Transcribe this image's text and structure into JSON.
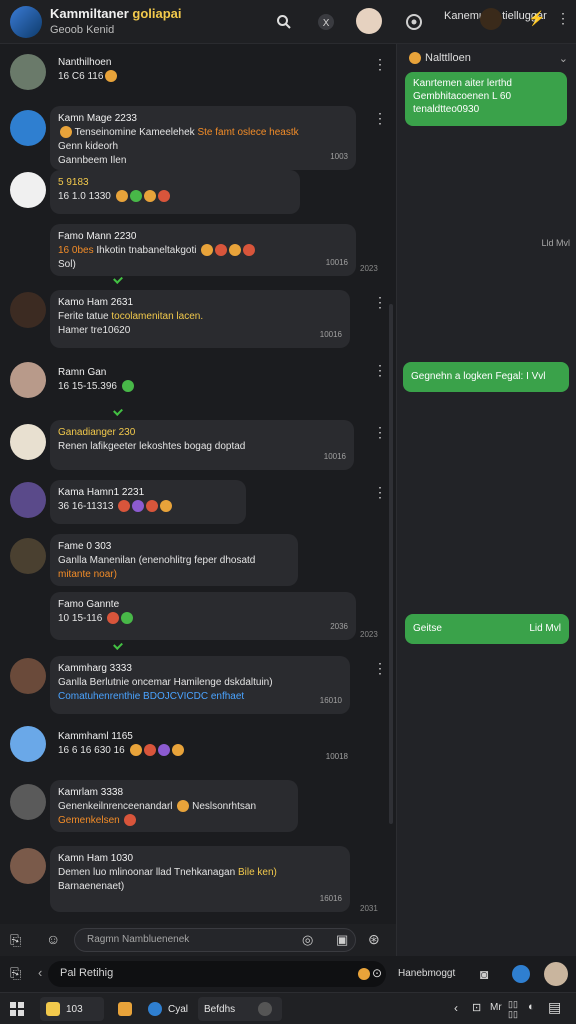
{
  "topbar": {
    "title_main": "Kammiltaner",
    "title_accent": "goliapai",
    "subtitle": "Geoob Kenid",
    "search_icon": "search-icon",
    "mute_icon": "mute-icon",
    "settings_icon": "gear-icon",
    "right_title": "Kanemunsi tielluggar"
  },
  "messages": [
    {
      "name": "Nanthilhoen",
      "text": "16 C6 116",
      "time": ""
    },
    {
      "name": "Kamn Mage 2233",
      "line1_pre": "Tenseinomine Kameelehek",
      "line1_hl": "Ste famt oslece heastk",
      "line2": "Genn kideorh",
      "line3": "Gannbeem Ilen",
      "time": "1003"
    },
    {
      "name": "5 9183",
      "text": "16 1.0 1330",
      "time": ""
    },
    {
      "name": "Famo Mann 2230",
      "line1_hl": "16 0bes",
      "line1_post": "Ihkotin tnabaneltakgoti",
      "line2": "Sol)",
      "time": "10016",
      "time2": "2023"
    },
    {
      "name": "Kamo Ham 2631",
      "line1": "Ferite tatue",
      "line1_hl": "tocolamenitan lacen.",
      "line2": "Hamer tre10620",
      "time": "10016"
    },
    {
      "name": "Ramn Gan",
      "text": "16 15-15.396",
      "time": ""
    },
    {
      "name": "Ganadianger 230",
      "line1": "Renen lafikgeeter  lekoshtes  bogag doptad",
      "time": "10016"
    },
    {
      "name": "Kama Hamn1 2231",
      "text": "36 16-11313",
      "time": ""
    },
    {
      "name": "Fame 0 303",
      "line1": "Ganlla Manenilan (enenohlitrg feper dhosatd",
      "line2_hl": "mitante noar)",
      "time": ""
    },
    {
      "name": "Famo Gannte",
      "text": "10 15-116",
      "time": "2036",
      "time2": "2023"
    },
    {
      "name": "Kammharg 3333",
      "line1": "Ganlla Berlutnie oncemar Hamilenge dskdaltuin)",
      "line2_hl": "Comatuhenrenthie BDOJCVICDC enfhaet",
      "time": "16010"
    },
    {
      "name": "Kammhaml 1165",
      "text": "16 6 16 630 16",
      "time": "10018"
    },
    {
      "name": "Kamrlam 3338",
      "line1": "Genenkeilnrenceenandarl",
      "line1_post": "Neslsonrhtsan",
      "line2_hl": "Gemenkelsen",
      "time": ""
    },
    {
      "name": "Kamn Ham 1030",
      "line1": "Demen luo mlinoonar llad",
      "line1_post": "Tnehkanagan",
      "line1_hl": "Bile ken)",
      "line2": "Barnaenenaet)",
      "time": "16016",
      "time2": "2031"
    }
  ],
  "side": {
    "header": "Nalttlloen",
    "bubble1_l1": "Kanrtemen aiter lerthd",
    "bubble1_l2": "Gembhitacoenen L 60",
    "bubble1_l3": "tenaldtteo0930",
    "time_a": "Lld Mvl",
    "bubble2": "Gegnehn a logken Fegal: I Vvl",
    "bubble3": "Geitse",
    "bubble3_time": "Lid Mvl"
  },
  "composer": {
    "placeholder": "Ragmn Nambluenenek",
    "reply_label": "Pal Retihig"
  },
  "bottom_right": {
    "label": "Hanebmoggt"
  },
  "taskbar": {
    "item1": "103",
    "item2": "Cyal",
    "item3": "Befdhs",
    "tray_label": "Mr"
  },
  "colors": {
    "accent": "#f2c94c",
    "green": "#3aa24a",
    "orange": "#f28c28",
    "blue": "#4aa3ff"
  }
}
